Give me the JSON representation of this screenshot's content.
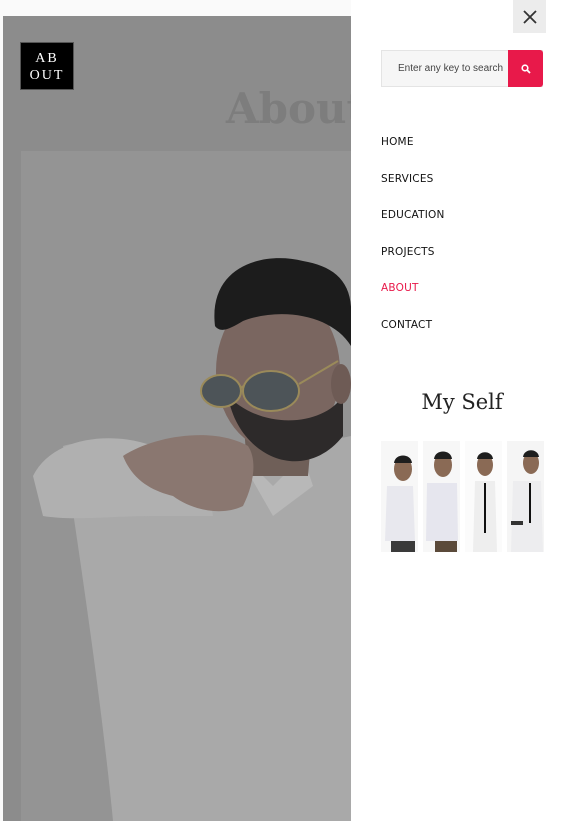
{
  "page": {
    "logo_line1": "AB",
    "logo_line2": "OUT",
    "hero_title": "About"
  },
  "panel": {
    "close_icon": "close-icon",
    "search": {
      "placeholder": "Enter any key to search",
      "button_icon": "search-icon"
    },
    "nav_items": [
      {
        "label": "HOME",
        "active": false
      },
      {
        "label": "SERVICES",
        "active": false
      },
      {
        "label": "EDUCATION",
        "active": false
      },
      {
        "label": "PROJECTS",
        "active": false
      },
      {
        "label": "ABOUT",
        "active": true
      },
      {
        "label": "CONTACT",
        "active": false
      }
    ],
    "section_title": "My Self"
  },
  "colors": {
    "accent": "#e8194a",
    "overlay": "#8c8c8c"
  }
}
